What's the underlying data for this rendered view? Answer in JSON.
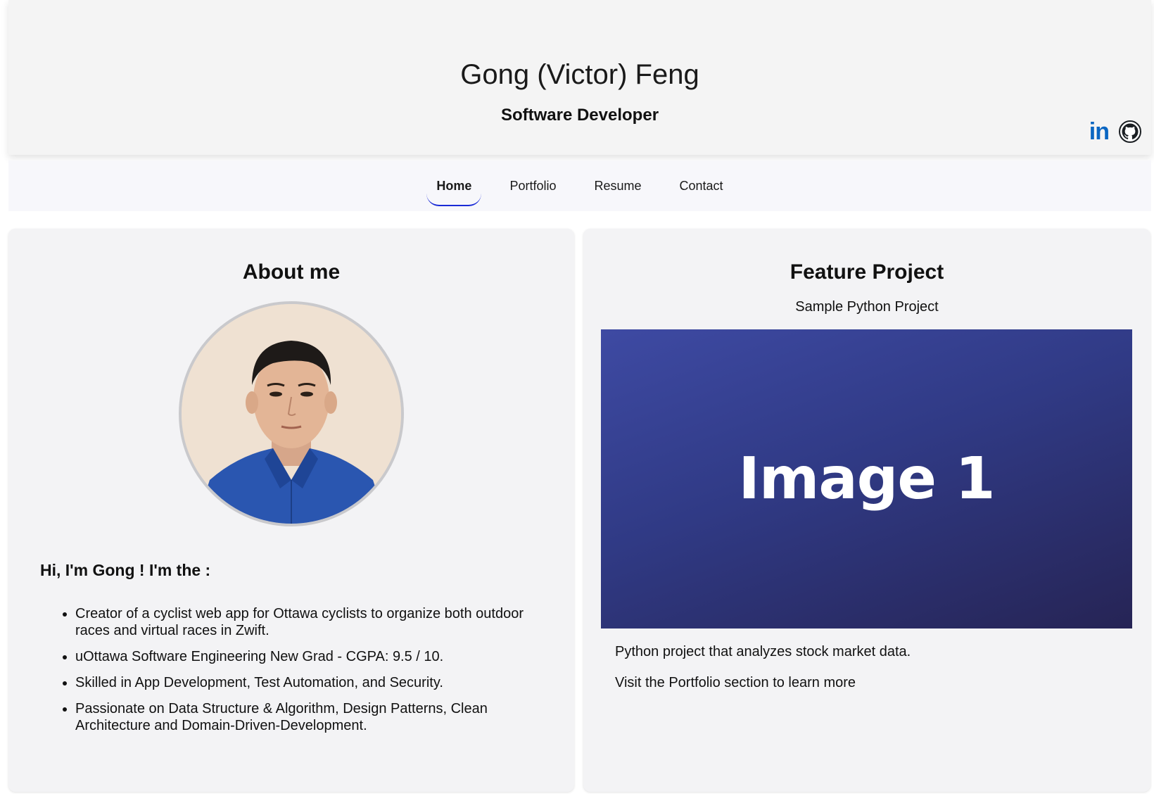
{
  "header": {
    "name": "Gong (Victor) Feng",
    "role": "Software Developer",
    "social": {
      "linkedin_label": "in",
      "linkedin_icon": "linkedin-icon",
      "github_icon": "github-icon"
    }
  },
  "nav": {
    "tabs": [
      {
        "label": "Home",
        "active": true
      },
      {
        "label": "Portfolio"
      },
      {
        "label": "Resume"
      },
      {
        "label": "Contact"
      }
    ]
  },
  "about": {
    "title": "About me",
    "greeting": "Hi, I'm Gong ! I'm the :",
    "bullets": [
      "Creator of a cyclist web app for Ottawa cyclists to organize both outdoor races and virtual races in Zwift.",
      "uOttawa Software Engineering New Grad - CGPA: 9.5 / 10.",
      "Skilled in App Development, Test Automation, and Security.",
      "Passionate on Data Structure & Algorithm, Design Patterns, Clean Architecture and Domain-Driven-Development."
    ]
  },
  "feature": {
    "title": "Feature Project",
    "subtitle": "Sample Python Project",
    "image_label": "Image 1",
    "description": "Python project that analyzes stock market data.",
    "more": "Visit the Portfolio section to learn more"
  },
  "colors": {
    "linkedin": "#0a66c2",
    "nav_underline": "#1a2bd6",
    "project_bg_start": "#3e4aa3",
    "project_bg_end": "#262455"
  }
}
